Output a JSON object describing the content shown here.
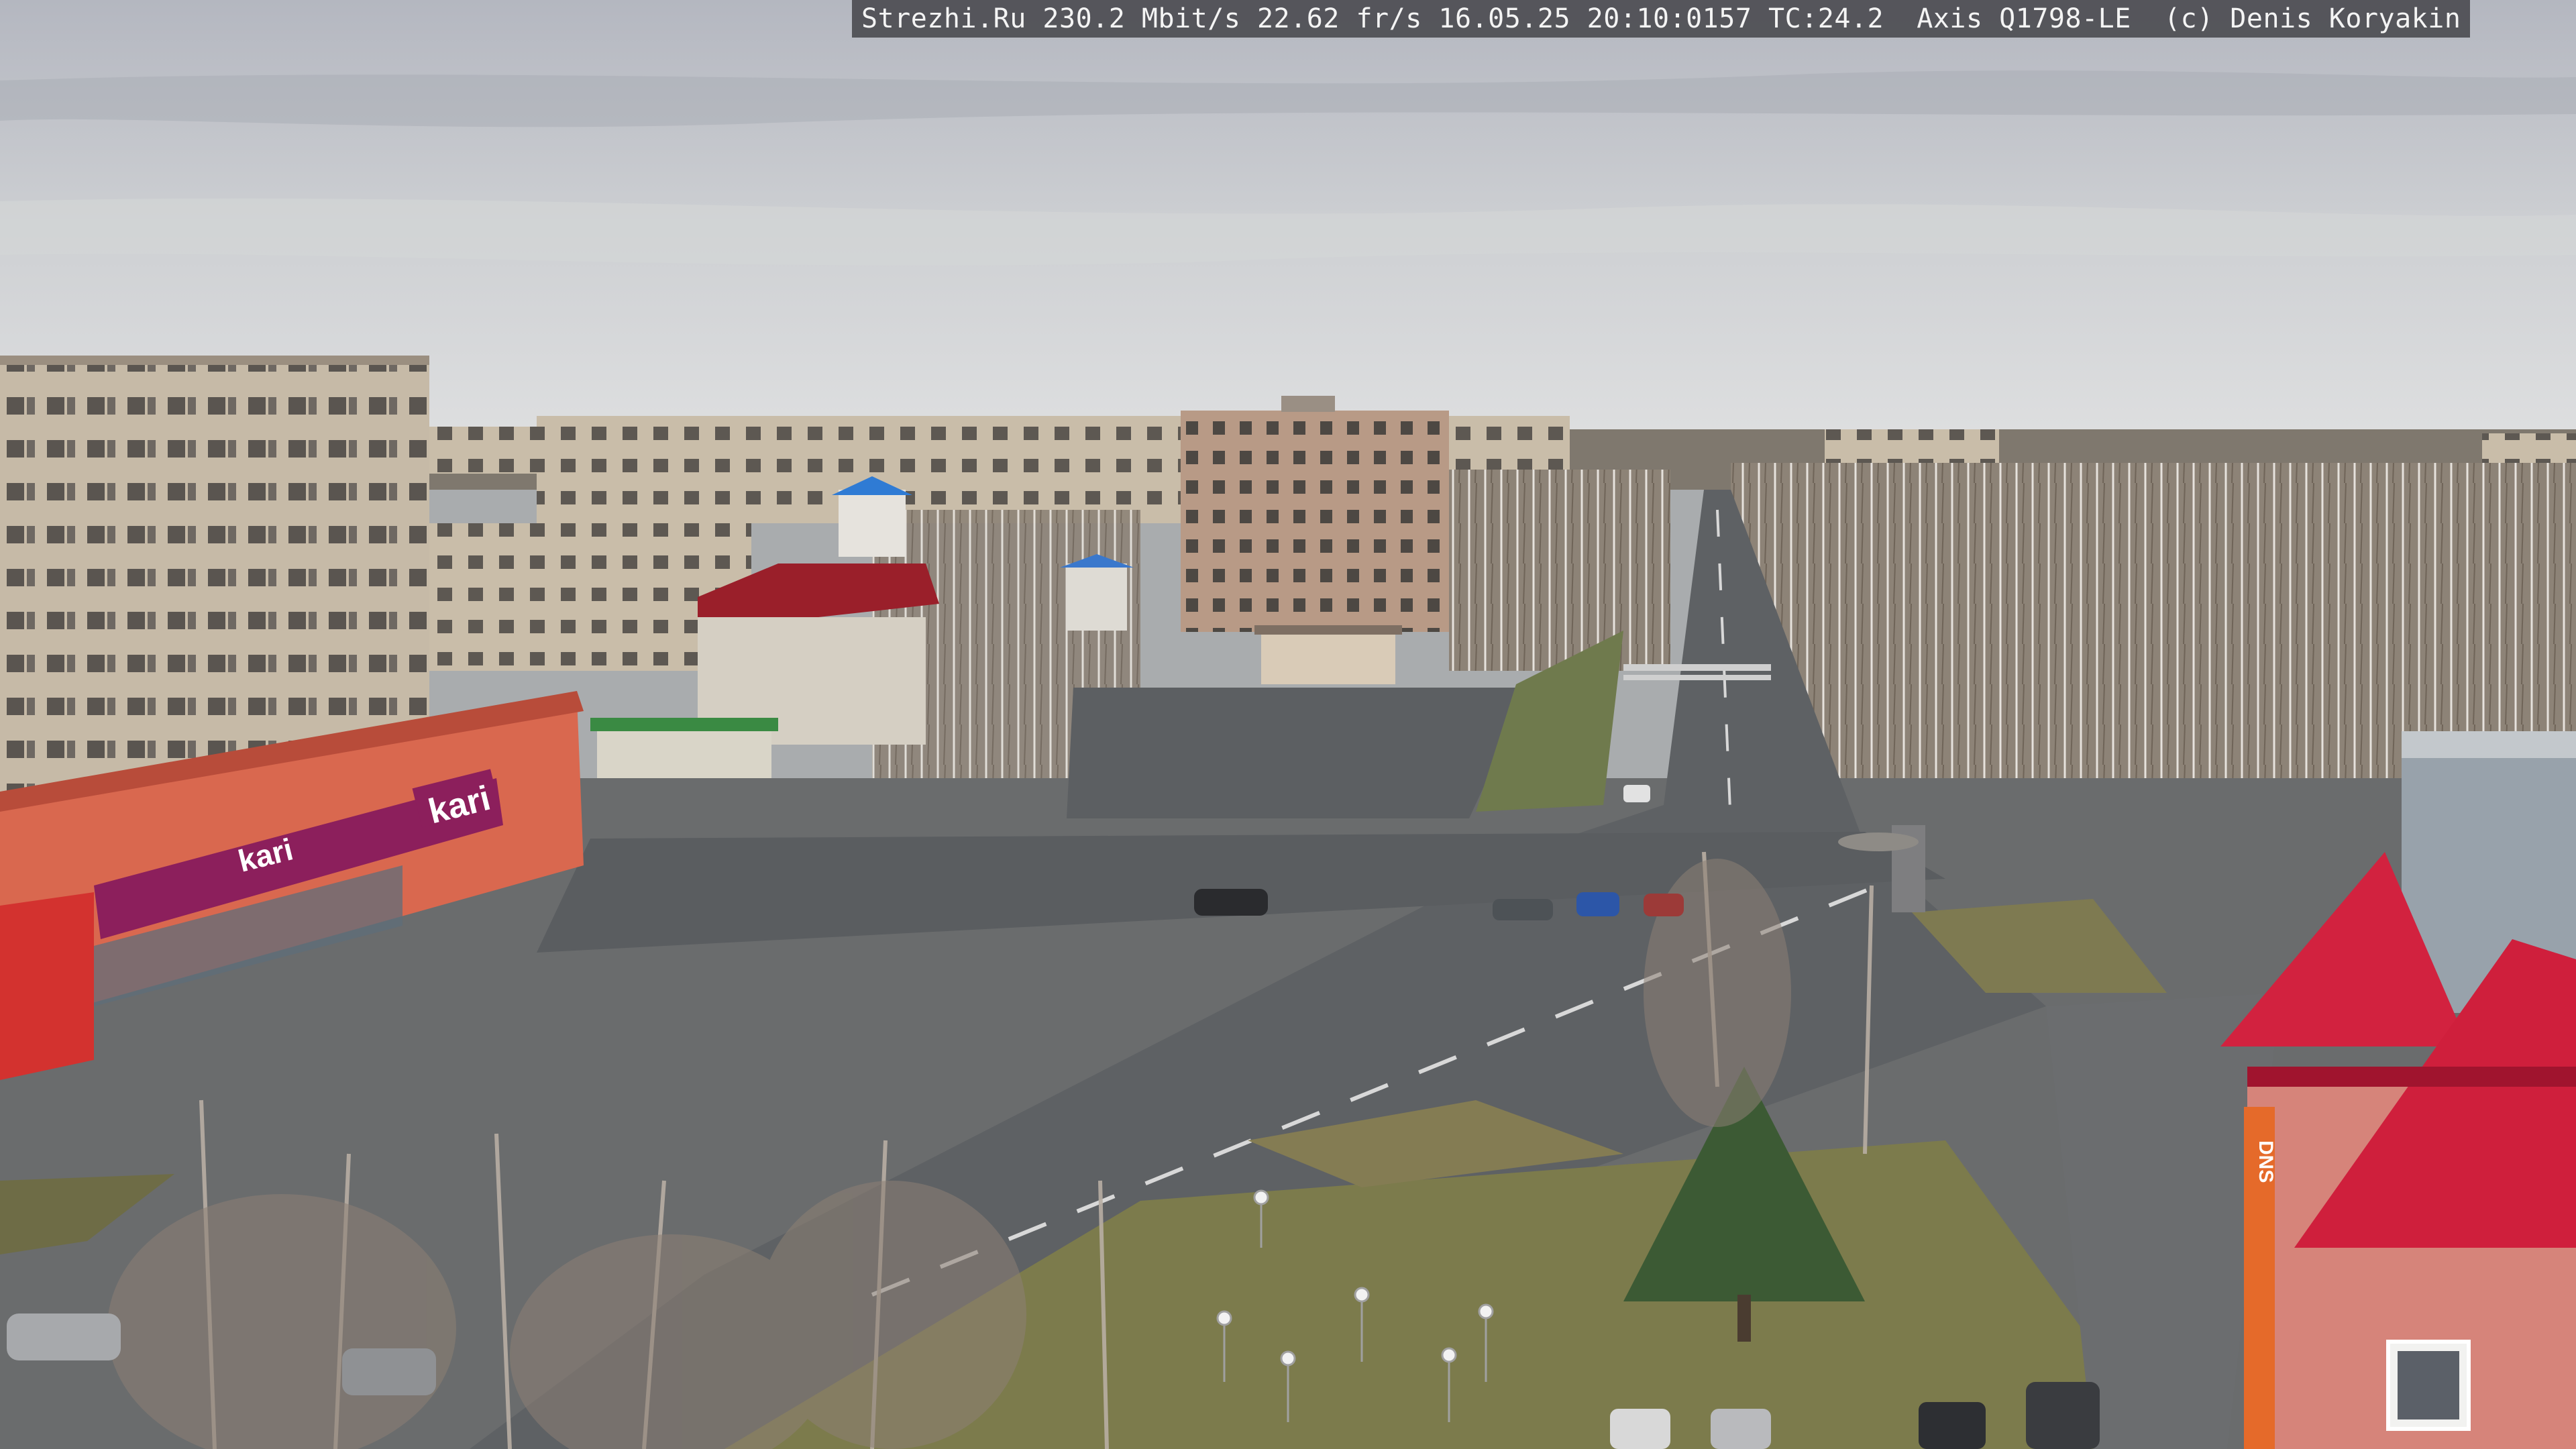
{
  "overlay": {
    "text": "Strezhi.Ru 230.2 Mbit/s 22.62 fr/s 16.05.25 20:10:0157 TC:24.2  Axis Q1798-LE  (c) Denis Koryakin"
  },
  "signs": {
    "store_big": "kari",
    "store_main": "kari",
    "dns_vertical": "DNS"
  },
  "colors": {
    "sky_top": "#b9bcc4",
    "sky_horizon": "#d9dbdc",
    "road": "#5d6063",
    "kari_magenta": "#8c1f5c",
    "roof_red": "#c8193a",
    "shop_orange": "#d9684f",
    "grass": "#7c7a4a",
    "panel_building": "#c5b9a6"
  }
}
